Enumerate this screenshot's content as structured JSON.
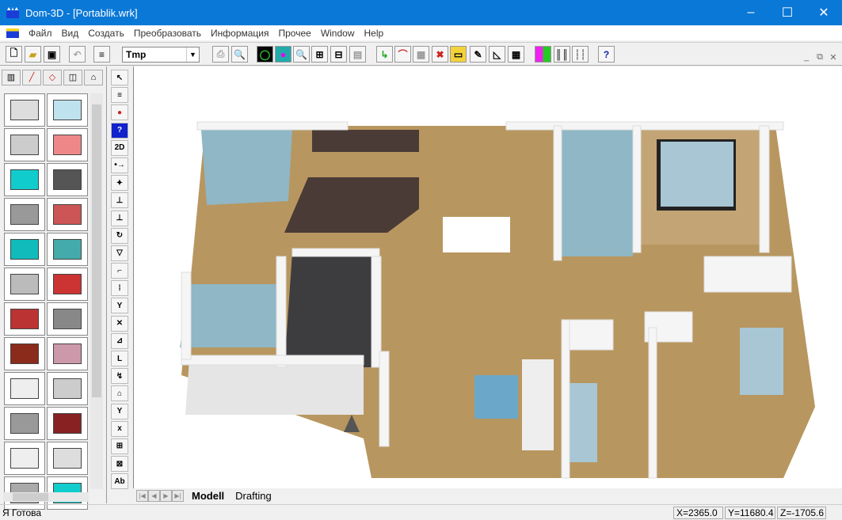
{
  "window": {
    "title": "Dom-3D - [Portablik.wrk]",
    "minimize": "–",
    "maximize": "☐",
    "close": "✕"
  },
  "menu": [
    "Файл",
    "Вид",
    "Создать",
    "Преобразовать",
    "Информация",
    "Прочее",
    "Window",
    "Help"
  ],
  "toolbar": {
    "layer_combo": "Tmp",
    "help": "?"
  },
  "vertical_tools": {
    "mode_2d": "2D",
    "text_tool": "Ab"
  },
  "tabs": {
    "modell": "Modell",
    "drafting": "Drafting"
  },
  "status": {
    "text": "Я Готова",
    "x": "X=2365.0",
    "y": "Y=11680.4",
    "z": "Z=-1705.6"
  },
  "palette_items": [
    "wall",
    "floor-plan",
    "wall-opening",
    "arch",
    "window",
    "door",
    "stairs",
    "stair-rail",
    "window-frame",
    "window-panel",
    "roof",
    "spiral-stairs",
    "dormer",
    "hip-roof",
    "tiles",
    "polygon-p1",
    "column",
    "profile",
    "skylight",
    "roof-panel",
    "railing",
    "balustrade",
    "cabinet",
    "glass-door"
  ]
}
